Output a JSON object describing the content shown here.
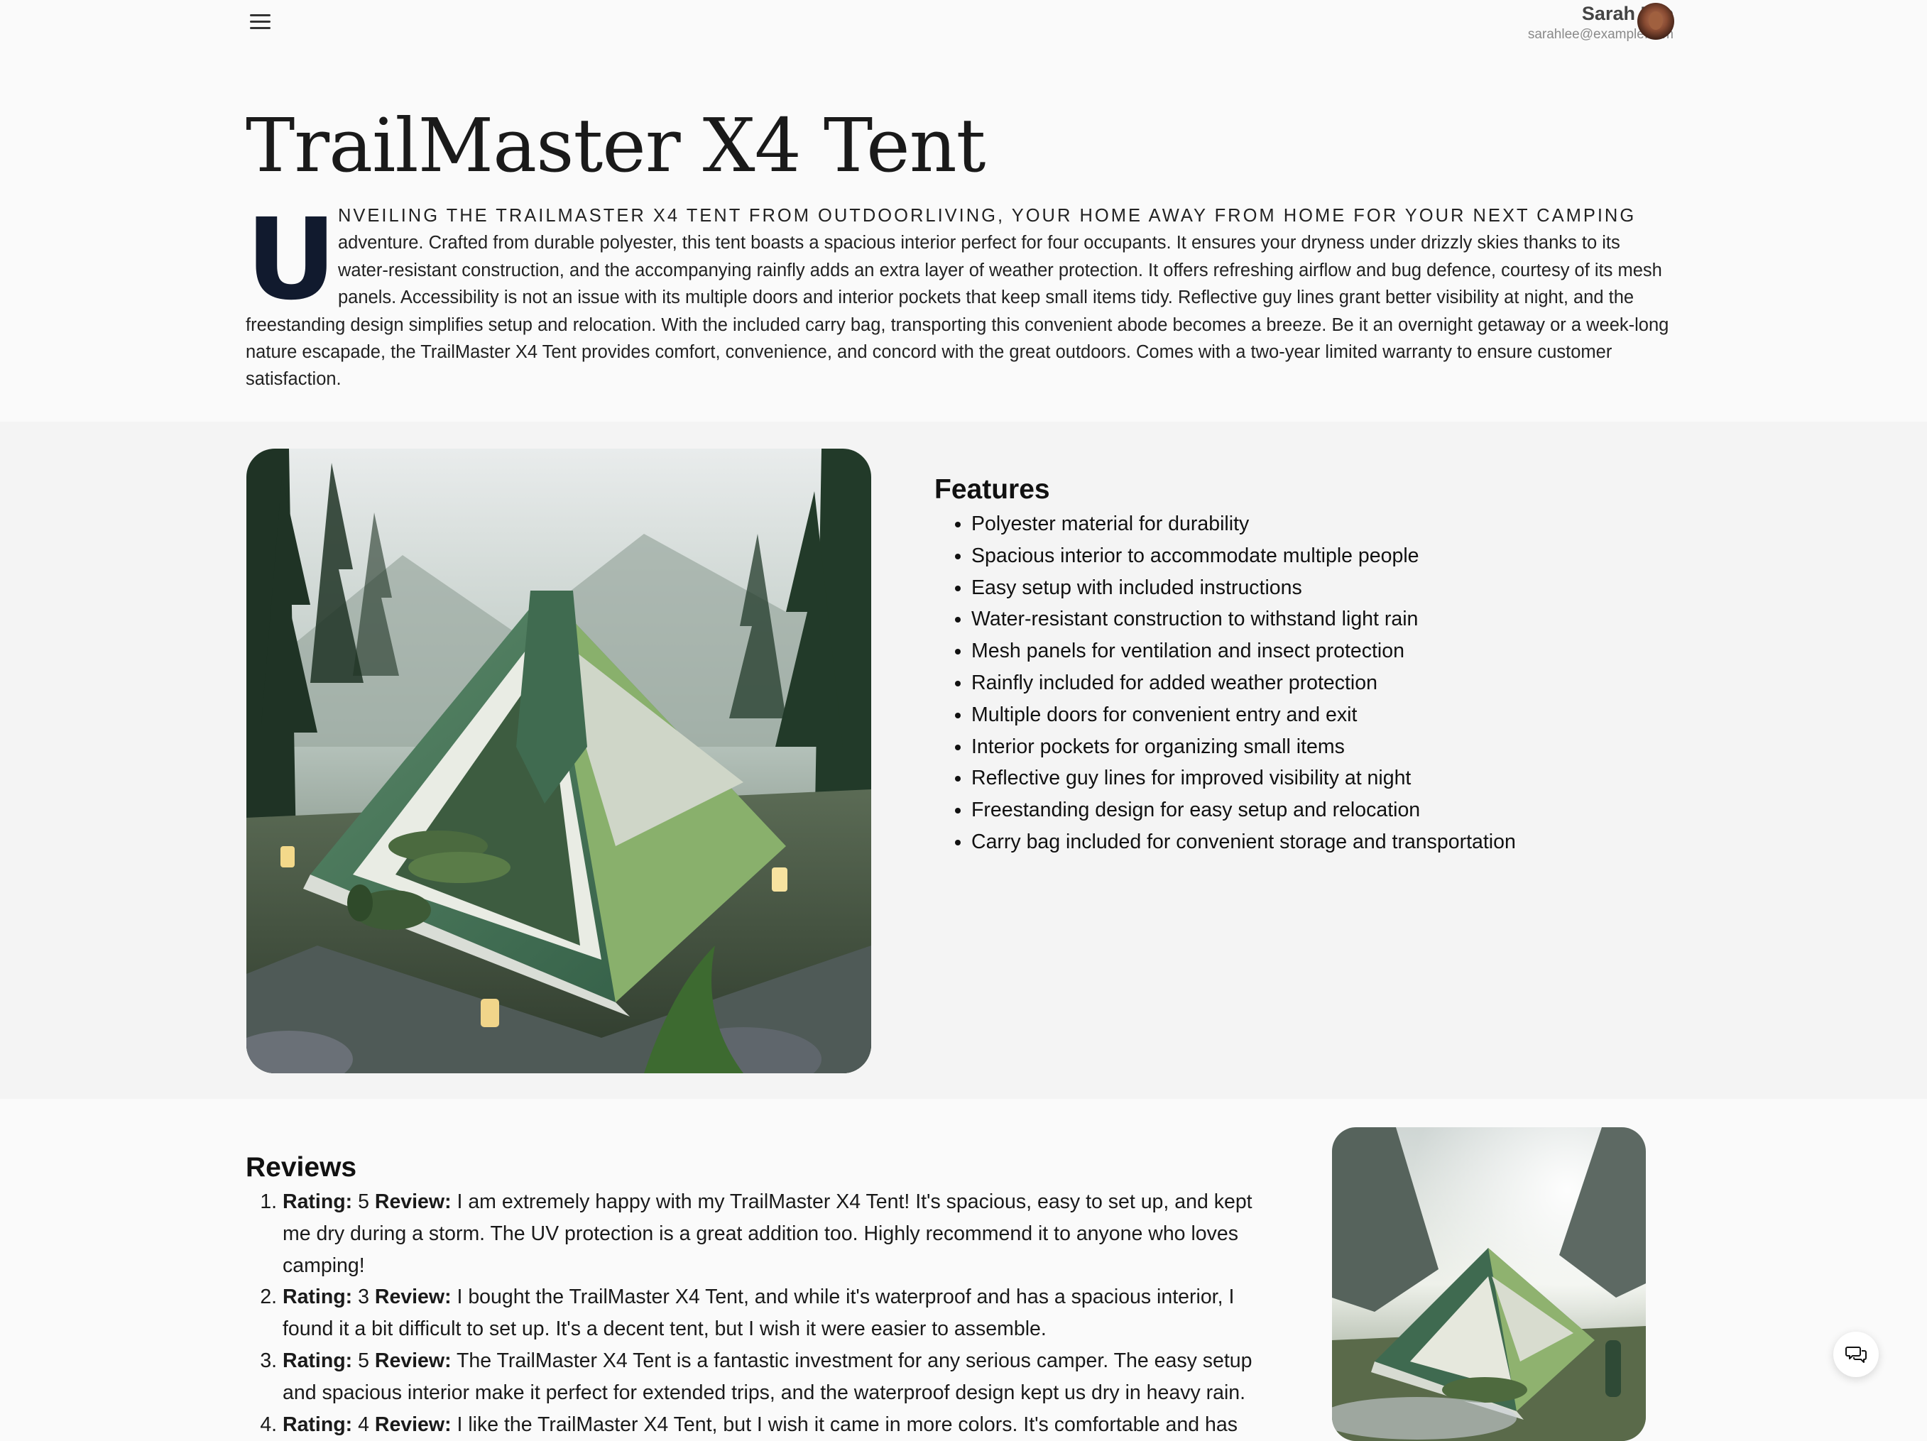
{
  "header": {
    "user_name": "Sarah Lee",
    "user_email": "sarahlee@example.com"
  },
  "product": {
    "title": "TrailMaster X4 Tent",
    "intro_drop_cap": "U",
    "intro_lead": "nveiling the TrailMaster X4 Tent from OutdoorLiving, your home away from home for your next camping",
    "intro_rest": " adventure. Crafted from durable polyester, this tent boasts a spacious interior perfect for four occupants. It ensures your dryness under drizzly skies thanks to its water-resistant construction, and the accompanying rainfly adds an extra layer of weather protection. It offers refreshing airflow and bug defence, courtesy of its mesh panels. Accessibility is not an issue with its multiple doors and interior pockets that keep small items tidy. Reflective guy lines grant better visibility at night, and the freestanding design simplifies setup and relocation. With the included carry bag, transporting this convenient abode becomes a breeze. Be it an overnight getaway or a week-long nature escapade, the TrailMaster X4 Tent provides comfort, convenience, and concord with the great outdoors. Comes with a two-year limited warranty to ensure customer satisfaction."
  },
  "features": {
    "heading": "Features",
    "items": [
      "Polyester material for durability",
      "Spacious interior to accommodate multiple people",
      "Easy setup with included instructions",
      "Water-resistant construction to withstand light rain",
      "Mesh panels for ventilation and insect protection",
      "Rainfly included for added weather protection",
      "Multiple doors for convenient entry and exit",
      "Interior pockets for organizing small items",
      "Reflective guy lines for improved visibility at night",
      "Freestanding design for easy setup and relocation",
      "Carry bag included for convenient storage and transportation"
    ]
  },
  "reviews": {
    "heading": "Reviews",
    "rating_label": "Rating:",
    "review_label": "Review:",
    "items": [
      {
        "rating": "5",
        "text": "I am extremely happy with my TrailMaster X4 Tent! It's spacious, easy to set up, and kept me dry during a storm. The UV protection is a great addition too. Highly recommend it to anyone who loves camping!"
      },
      {
        "rating": "3",
        "text": "I bought the TrailMaster X4 Tent, and while it's waterproof and has a spacious interior, I found it a bit difficult to set up. It's a decent tent, but I wish it were easier to assemble."
      },
      {
        "rating": "5",
        "text": "The TrailMaster X4 Tent is a fantastic investment for any serious camper. The easy setup and spacious interior make it perfect for extended trips, and the waterproof design kept us dry in heavy rain."
      },
      {
        "rating": "4",
        "text": "I like the TrailMaster X4 Tent, but I wish it came in more colors. It's comfortable and has"
      }
    ]
  },
  "icons": {
    "menu": "hamburger-menu-icon",
    "chat": "chat-bubbles-icon"
  },
  "colors": {
    "page_background": "#fafafa",
    "band_background": "#f4f4f4",
    "drop_cap": "#111a2e",
    "tent_green": "#3f6a4c"
  }
}
